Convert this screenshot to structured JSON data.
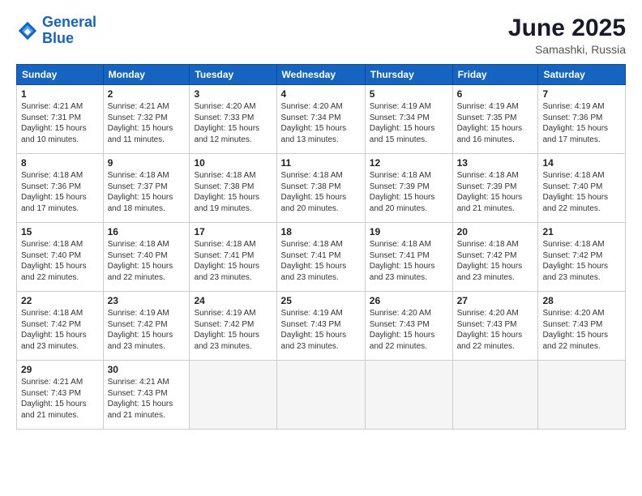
{
  "logo": {
    "line1": "General",
    "line2": "Blue"
  },
  "title": "June 2025",
  "location": "Samashki, Russia",
  "days_header": [
    "Sunday",
    "Monday",
    "Tuesday",
    "Wednesday",
    "Thursday",
    "Friday",
    "Saturday"
  ],
  "weeks": [
    [
      {
        "num": "1",
        "info": "Sunrise: 4:21 AM\nSunset: 7:31 PM\nDaylight: 15 hours\nand 10 minutes."
      },
      {
        "num": "2",
        "info": "Sunrise: 4:21 AM\nSunset: 7:32 PM\nDaylight: 15 hours\nand 11 minutes."
      },
      {
        "num": "3",
        "info": "Sunrise: 4:20 AM\nSunset: 7:33 PM\nDaylight: 15 hours\nand 12 minutes."
      },
      {
        "num": "4",
        "info": "Sunrise: 4:20 AM\nSunset: 7:34 PM\nDaylight: 15 hours\nand 13 minutes."
      },
      {
        "num": "5",
        "info": "Sunrise: 4:19 AM\nSunset: 7:34 PM\nDaylight: 15 hours\nand 15 minutes."
      },
      {
        "num": "6",
        "info": "Sunrise: 4:19 AM\nSunset: 7:35 PM\nDaylight: 15 hours\nand 16 minutes."
      },
      {
        "num": "7",
        "info": "Sunrise: 4:19 AM\nSunset: 7:36 PM\nDaylight: 15 hours\nand 17 minutes."
      }
    ],
    [
      {
        "num": "8",
        "info": "Sunrise: 4:18 AM\nSunset: 7:36 PM\nDaylight: 15 hours\nand 17 minutes."
      },
      {
        "num": "9",
        "info": "Sunrise: 4:18 AM\nSunset: 7:37 PM\nDaylight: 15 hours\nand 18 minutes."
      },
      {
        "num": "10",
        "info": "Sunrise: 4:18 AM\nSunset: 7:38 PM\nDaylight: 15 hours\nand 19 minutes."
      },
      {
        "num": "11",
        "info": "Sunrise: 4:18 AM\nSunset: 7:38 PM\nDaylight: 15 hours\nand 20 minutes."
      },
      {
        "num": "12",
        "info": "Sunrise: 4:18 AM\nSunset: 7:39 PM\nDaylight: 15 hours\nand 20 minutes."
      },
      {
        "num": "13",
        "info": "Sunrise: 4:18 AM\nSunset: 7:39 PM\nDaylight: 15 hours\nand 21 minutes."
      },
      {
        "num": "14",
        "info": "Sunrise: 4:18 AM\nSunset: 7:40 PM\nDaylight: 15 hours\nand 22 minutes."
      }
    ],
    [
      {
        "num": "15",
        "info": "Sunrise: 4:18 AM\nSunset: 7:40 PM\nDaylight: 15 hours\nand 22 minutes."
      },
      {
        "num": "16",
        "info": "Sunrise: 4:18 AM\nSunset: 7:40 PM\nDaylight: 15 hours\nand 22 minutes."
      },
      {
        "num": "17",
        "info": "Sunrise: 4:18 AM\nSunset: 7:41 PM\nDaylight: 15 hours\nand 23 minutes."
      },
      {
        "num": "18",
        "info": "Sunrise: 4:18 AM\nSunset: 7:41 PM\nDaylight: 15 hours\nand 23 minutes."
      },
      {
        "num": "19",
        "info": "Sunrise: 4:18 AM\nSunset: 7:41 PM\nDaylight: 15 hours\nand 23 minutes."
      },
      {
        "num": "20",
        "info": "Sunrise: 4:18 AM\nSunset: 7:42 PM\nDaylight: 15 hours\nand 23 minutes."
      },
      {
        "num": "21",
        "info": "Sunrise: 4:18 AM\nSunset: 7:42 PM\nDaylight: 15 hours\nand 23 minutes."
      }
    ],
    [
      {
        "num": "22",
        "info": "Sunrise: 4:18 AM\nSunset: 7:42 PM\nDaylight: 15 hours\nand 23 minutes."
      },
      {
        "num": "23",
        "info": "Sunrise: 4:19 AM\nSunset: 7:42 PM\nDaylight: 15 hours\nand 23 minutes."
      },
      {
        "num": "24",
        "info": "Sunrise: 4:19 AM\nSunset: 7:42 PM\nDaylight: 15 hours\nand 23 minutes."
      },
      {
        "num": "25",
        "info": "Sunrise: 4:19 AM\nSunset: 7:43 PM\nDaylight: 15 hours\nand 23 minutes."
      },
      {
        "num": "26",
        "info": "Sunrise: 4:20 AM\nSunset: 7:43 PM\nDaylight: 15 hours\nand 22 minutes."
      },
      {
        "num": "27",
        "info": "Sunrise: 4:20 AM\nSunset: 7:43 PM\nDaylight: 15 hours\nand 22 minutes."
      },
      {
        "num": "28",
        "info": "Sunrise: 4:20 AM\nSunset: 7:43 PM\nDaylight: 15 hours\nand 22 minutes."
      }
    ],
    [
      {
        "num": "29",
        "info": "Sunrise: 4:21 AM\nSunset: 7:43 PM\nDaylight: 15 hours\nand 21 minutes."
      },
      {
        "num": "30",
        "info": "Sunrise: 4:21 AM\nSunset: 7:43 PM\nDaylight: 15 hours\nand 21 minutes."
      },
      null,
      null,
      null,
      null,
      null
    ]
  ]
}
